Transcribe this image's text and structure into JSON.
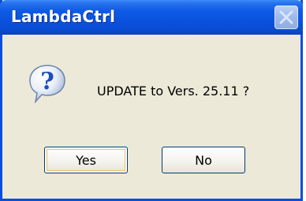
{
  "window": {
    "title": "LambdaCtrl",
    "close_icon": "close-icon"
  },
  "dialog": {
    "icon": "question-icon",
    "message": "UPDATE to Vers. 25.11 ?"
  },
  "buttons": {
    "yes_label": "Yes",
    "no_label": "No"
  },
  "colors": {
    "titlebar": "#0a52de",
    "client_area": "#ece9d8",
    "button_border": "#003c74",
    "focus_ring": "#f0c060"
  }
}
